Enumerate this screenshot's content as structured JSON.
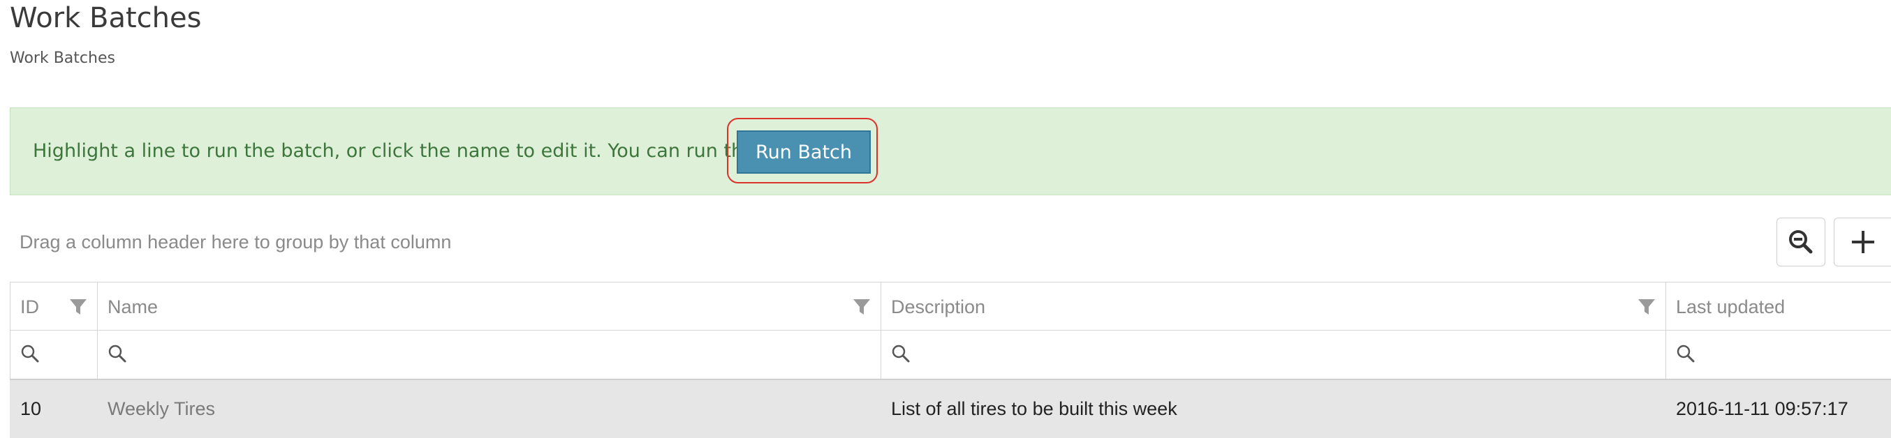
{
  "page": {
    "title": "Work Batches",
    "breadcrumb": "Work Batches"
  },
  "alert": {
    "message": "Highlight a line to run the batch, or click the name to edit it. You can run this batch!",
    "run_button_label": "Run Batch"
  },
  "grid": {
    "group_panel_hint": "Drag a column header here to group by that column",
    "toolbar": {
      "zoom_icon": "zoom-out-icon",
      "add_icon": "plus-icon"
    },
    "columns": [
      {
        "key": "id",
        "label": "ID"
      },
      {
        "key": "name",
        "label": "Name"
      },
      {
        "key": "description",
        "label": "Description"
      },
      {
        "key": "last_updated",
        "label": "Last updated"
      }
    ],
    "rows": [
      {
        "id": "10",
        "name": "Weekly Tires",
        "description": "List of all tires to be built this week",
        "last_updated": "2016-11-11 09:57:17"
      }
    ]
  },
  "colors": {
    "alert_bg": "#dff0d8",
    "alert_text": "#3c763d",
    "run_button": "#4a91b1",
    "highlight_ring": "#d9332c",
    "selected_row": "#e6e6e6"
  }
}
